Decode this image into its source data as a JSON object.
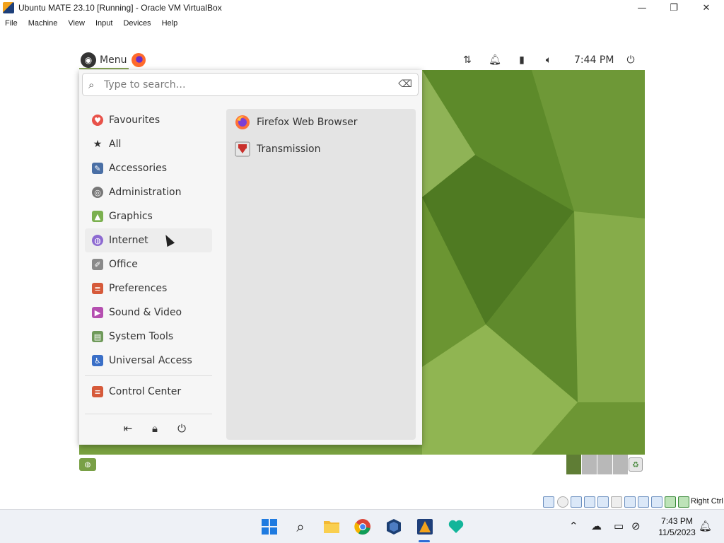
{
  "window": {
    "title": "Ubuntu MATE 23.10 [Running] - Oracle VM VirtualBox",
    "minimize_glyph": "—",
    "maximize_glyph": "❐",
    "close_glyph": "✕"
  },
  "menubar": [
    "File",
    "Machine",
    "View",
    "Input",
    "Devices",
    "Help"
  ],
  "top_panel": {
    "menu_label": "Menu",
    "clock": "7:44 PM",
    "tray_icons": [
      "network-icon",
      "notification-bell-icon",
      "battery-icon",
      "volume-icon",
      "power-icon"
    ]
  },
  "mate_menu": {
    "search_placeholder": "Type to search…",
    "categories": [
      {
        "label": "Favourites",
        "icon": "heart-icon",
        "color": "#e8524a"
      },
      {
        "label": "All",
        "icon": "star-icon",
        "color": "#333333"
      },
      {
        "label": "Accessories",
        "icon": "accessories-icon",
        "color": "#4a6fa5"
      },
      {
        "label": "Administration",
        "icon": "administration-icon",
        "color": "#777777"
      },
      {
        "label": "Graphics",
        "icon": "graphics-icon",
        "color": "#7bb04f"
      },
      {
        "label": "Internet",
        "icon": "internet-icon",
        "color": "#8d6ad1"
      },
      {
        "label": "Office",
        "icon": "office-icon",
        "color": "#8a8a8a"
      },
      {
        "label": "Preferences",
        "icon": "preferences-icon",
        "color": "#d65a3a"
      },
      {
        "label": "Sound & Video",
        "icon": "sound-video-icon",
        "color": "#b54fb0"
      },
      {
        "label": "System Tools",
        "icon": "system-tools-icon",
        "color": "#6f9a5a"
      },
      {
        "label": "Universal Access",
        "icon": "universal-access-icon",
        "color": "#3a6fc7"
      }
    ],
    "control_center": {
      "label": "Control Center",
      "icon": "control-center-icon",
      "color": "#d65a3a"
    },
    "apps": [
      {
        "label": "Firefox Web Browser",
        "icon": "firefox-icon"
      },
      {
        "label": "Transmission",
        "icon": "transmission-icon"
      }
    ],
    "bottom_buttons": [
      "logout-icon",
      "lock-icon",
      "power-icon"
    ]
  },
  "vbox_status": {
    "host_key": "Right Ctrl"
  },
  "taskbar": {
    "apps": [
      "start-icon",
      "search-icon",
      "file-explorer-icon",
      "chrome-icon",
      "virtualbox-icon",
      "virtualbox-vm-icon",
      "heart-app-icon"
    ],
    "time": "7:43 PM",
    "date": "11/5/2023"
  }
}
